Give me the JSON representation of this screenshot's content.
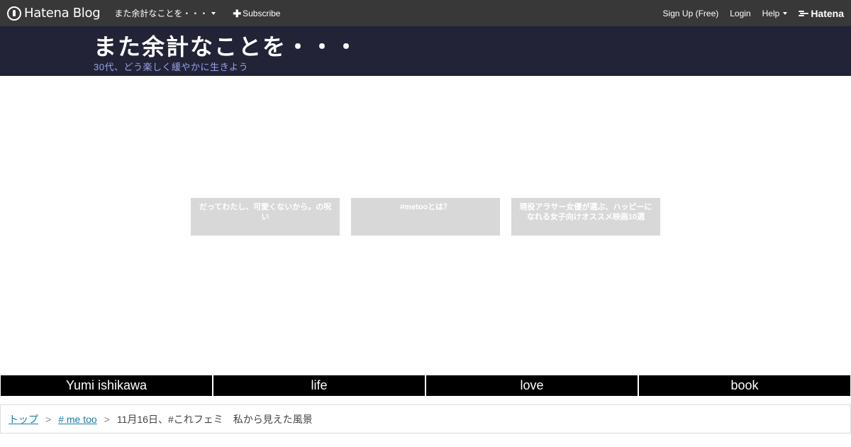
{
  "globalbar": {
    "brand": "Hatena Blog",
    "blog_menu": "また余計なことを・・・",
    "subscribe": "Subscribe",
    "signup": "Sign Up (Free)",
    "login": "Login",
    "help": "Help",
    "hatena": "Hatena"
  },
  "header": {
    "title": "また余計なことを・・・",
    "description": "30代、どう楽しく緩やかに生きよう"
  },
  "related": [
    {
      "title": "だってわたし、可愛くないから。の呪い"
    },
    {
      "title": "#metooとは？"
    },
    {
      "title": "現役アラサー女優が選ぶ、ハッピーになれる女子向けオススメ映画10選"
    }
  ],
  "categories": [
    "Yumi ishikawa",
    "life",
    "love",
    "book"
  ],
  "breadcrumb": {
    "top": "トップ",
    "category": "# me too",
    "current": "11月16日、#これフェミ　私から見えた風景",
    "separator": ">"
  }
}
